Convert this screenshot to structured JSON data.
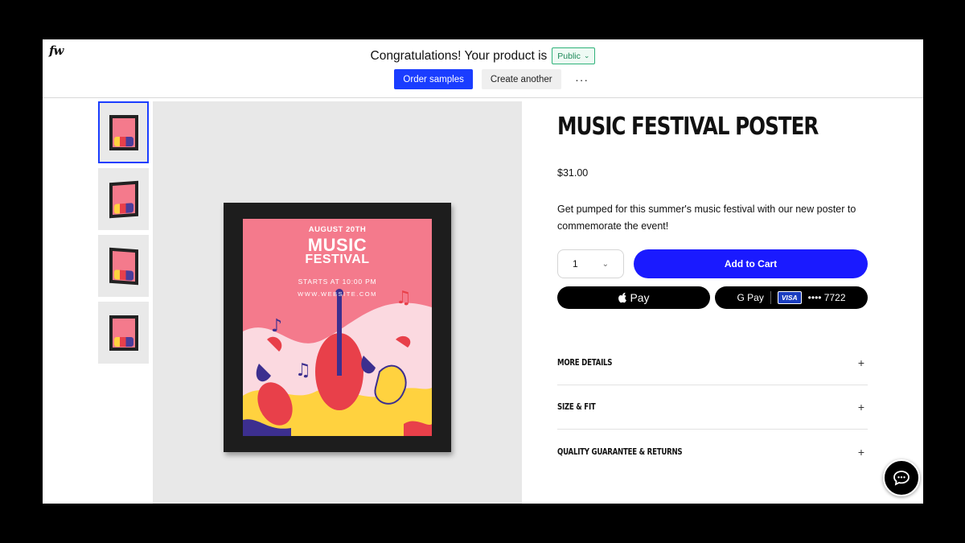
{
  "topbar": {
    "logo": "fw",
    "congrats": "Congratulations! Your product is",
    "visibility": "Public",
    "order_samples": "Order samples",
    "create_another": "Create another",
    "more": "···"
  },
  "gallery": {
    "thumbnails": [
      "thumbnail-1",
      "thumbnail-2",
      "thumbnail-3",
      "thumbnail-4"
    ],
    "active_index": 0
  },
  "poster": {
    "date": "AUGUST 20TH",
    "title_line1": "MUSIC",
    "title_line2": "FESTIVAL",
    "time": "STARTS AT 10:00 PM",
    "website": "WWW.WEBSITE.COM",
    "colors": {
      "background": "#f47a8c",
      "yellow": "#ffd23f",
      "red": "#e8404a",
      "purple": "#3c2f8f"
    }
  },
  "product": {
    "title": "MUSIC FESTIVAL POSTER",
    "price": "$31.00",
    "description": "Get pumped for this summer's music festival with our new poster to commemorate the event!",
    "quantity": "1",
    "add_to_cart": "Add to Cart",
    "apple_pay": "Pay",
    "google_pay": "G Pay",
    "card_brand": "VISA",
    "card_last4": "•••• 7722"
  },
  "accordion": [
    {
      "label": "MORE DETAILS",
      "icon": "+"
    },
    {
      "label": "SIZE & FIT",
      "icon": "+"
    },
    {
      "label": "QUALITY GUARANTEE & RETURNS",
      "icon": "+"
    }
  ],
  "colors": {
    "accent": "#1a3dff",
    "public_green": "#2fb27a"
  }
}
